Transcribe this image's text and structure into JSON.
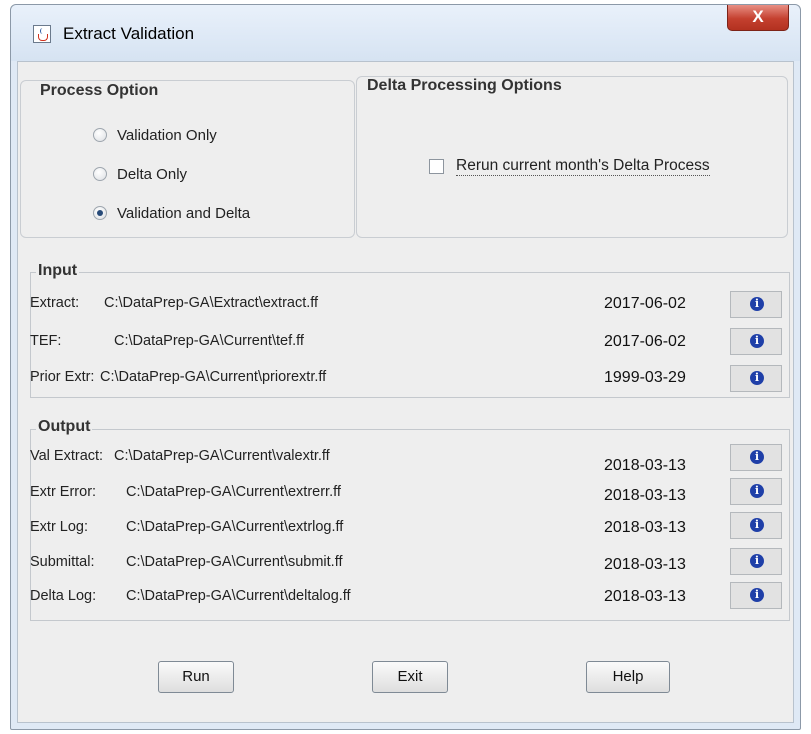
{
  "window": {
    "title": "Extract Validation",
    "close_symbol": "X"
  },
  "process_option": {
    "title": "Process Option",
    "options": [
      {
        "label": "Validation Only",
        "selected": false
      },
      {
        "label": "Delta Only",
        "selected": false
      },
      {
        "label": "Validation and Delta",
        "selected": true
      }
    ]
  },
  "delta_options": {
    "title": "Delta Processing Options",
    "rerun_label": "Rerun current month's Delta Process",
    "rerun_checked": false
  },
  "input": {
    "title": "Input",
    "rows": [
      {
        "label": "Extract:",
        "path": "C:\\DataPrep-GA\\Extract\\extract.ff",
        "date": "2017-06-02"
      },
      {
        "label": "TEF:",
        "path": "C:\\DataPrep-GA\\Current\\tef.ff",
        "date": "2017-06-02"
      },
      {
        "label": "Prior Extr:",
        "path": "C:\\DataPrep-GA\\Current\\priorextr.ff",
        "date": "1999-03-29"
      }
    ]
  },
  "output": {
    "title": "Output",
    "rows": [
      {
        "label": "Val Extract:",
        "path": "C:\\DataPrep-GA\\Current\\valextr.ff",
        "date": "2018-03-13"
      },
      {
        "label": "Extr Error:",
        "path": "C:\\DataPrep-GA\\Current\\extrerr.ff",
        "date": "2018-03-13"
      },
      {
        "label": "Extr Log:",
        "path": "C:\\DataPrep-GA\\Current\\extrlog.ff",
        "date": "2018-03-13"
      },
      {
        "label": "Submittal:",
        "path": "C:\\DataPrep-GA\\Current\\submit.ff",
        "date": "2018-03-13"
      },
      {
        "label": "Delta Log:",
        "path": "C:\\DataPrep-GA\\Current\\deltalog.ff",
        "date": "2018-03-13"
      }
    ]
  },
  "info_icon": "info-icon",
  "buttons": {
    "run": "Run",
    "exit": "Exit",
    "help": "Help"
  }
}
